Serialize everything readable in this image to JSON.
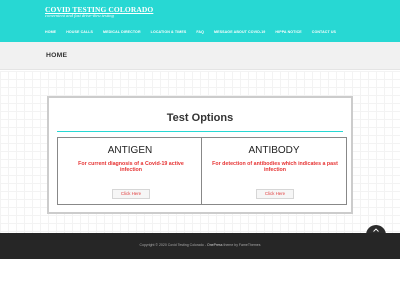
{
  "header": {
    "site_title": "COVID TESTING COLORADO",
    "tagline": "convenient and fast drive-thru testing",
    "nav": [
      {
        "label": "HOME"
      },
      {
        "label": "HOUSE CALLS"
      },
      {
        "label": "MEDICAL DIRECTOR"
      },
      {
        "label": "LOCATION & TIMES"
      },
      {
        "label": "FAQ"
      },
      {
        "label": "MESSAGE ABOUT COVID-19"
      },
      {
        "label": "HIPPA NOTICE"
      },
      {
        "label": "CONTACT US"
      }
    ]
  },
  "page": {
    "title": "HOME"
  },
  "test_options": {
    "title": "Test Options",
    "cards": [
      {
        "name": "ANTIGEN",
        "description": "For current diagnosis of a Covid-19 active infection",
        "button": "Click Here"
      },
      {
        "name": "ANTIBODY",
        "description": "For detection of antibodies which indicates a past infection",
        "button": "Click Here"
      }
    ]
  },
  "footer": {
    "copyright": "Copyright © 2020 Covid Testing Colorado -",
    "theme_name": "OnePress",
    "theme_credit": "theme by FameThemes"
  },
  "colors": {
    "brand": "#27d8d3",
    "accent_red": "#e63232",
    "footer_bg": "#262626"
  },
  "icons": {
    "back_to_top": "chevron-up-icon"
  }
}
